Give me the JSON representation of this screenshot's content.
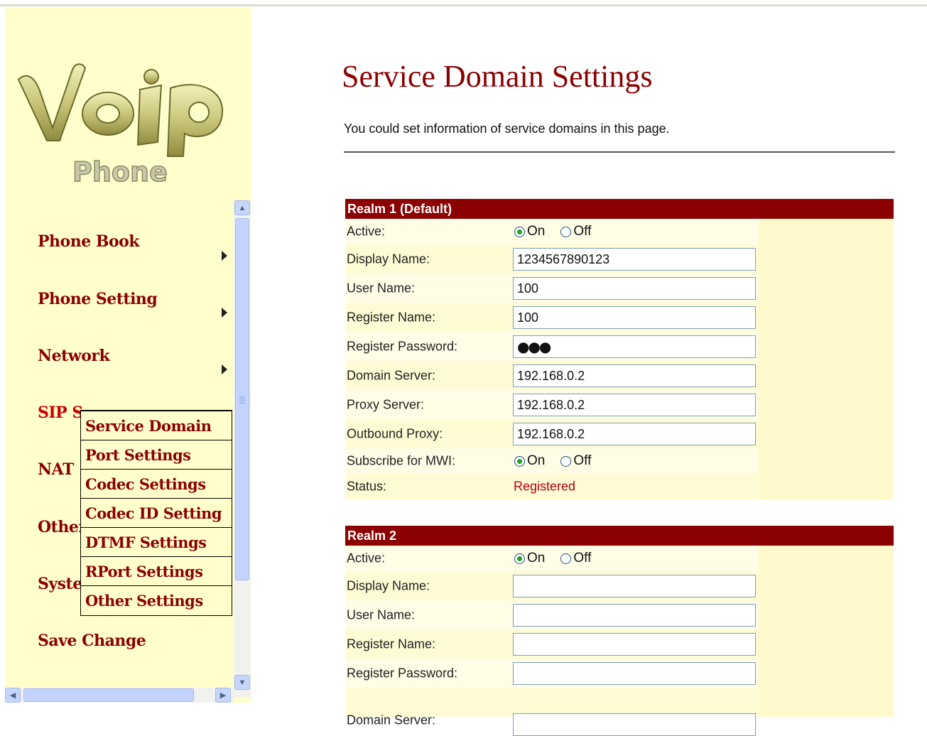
{
  "logo": {
    "word": "VoIP",
    "sub": "Phone"
  },
  "menu": {
    "items": [
      {
        "label": "Phone Book",
        "has_arrow": true
      },
      {
        "label": "Phone Setting",
        "has_arrow": true
      },
      {
        "label": "Network",
        "has_arrow": true
      },
      {
        "label": "SIP S",
        "has_arrow": false,
        "active": true
      },
      {
        "label": "NAT",
        "has_arrow": false
      },
      {
        "label": "Other",
        "has_arrow": false
      },
      {
        "label": "Syste",
        "has_arrow": false
      },
      {
        "label": "Save Change",
        "has_arrow": false
      }
    ],
    "submenu": [
      "Service Domain",
      "Port Settings",
      "Codec Settings",
      "Codec ID Setting",
      "DTMF Settings",
      "RPort Settings",
      "Other Settings"
    ]
  },
  "page": {
    "title": "Service Domain Settings",
    "description": "You could set information of service domains in this page."
  },
  "labels": {
    "active": "Active:",
    "display_name": "Display Name:",
    "user_name": "User Name:",
    "register_name": "Register Name:",
    "register_password": "Register Password:",
    "domain_server": "Domain Server:",
    "proxy_server": "Proxy Server:",
    "outbound_proxy": "Outbound Proxy:",
    "subscribe_mwi": "Subscribe for MWI:",
    "status": "Status:",
    "on": "On",
    "off": "Off"
  },
  "realm1": {
    "header": "Realm 1 (Default)",
    "active": "On",
    "display_name": "1234567890123",
    "user_name": "100",
    "register_name": "100",
    "register_password": "●●●",
    "domain_server": "192.168.0.2",
    "proxy_server": "192.168.0.2",
    "outbound_proxy": "192.168.0.2",
    "subscribe_mwi": "On",
    "status": "Registered"
  },
  "realm2": {
    "header": "Realm 2",
    "active": "On",
    "display_name": "",
    "user_name": "",
    "register_name": "",
    "register_password": "",
    "domain_server_label": "Domain Server:"
  },
  "colors": {
    "accent": "#8b0000",
    "sidebar_bg": "#ffffcc",
    "status": "#b0001a"
  }
}
